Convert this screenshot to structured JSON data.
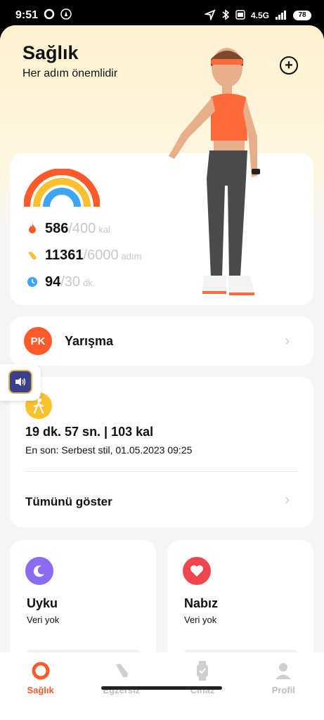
{
  "status_bar": {
    "time": "9:51",
    "network": "4.5G",
    "battery": "78",
    "icons": [
      "circle-icon",
      "notification-icon",
      "location-icon",
      "bluetooth-icon",
      "volte-icon",
      "signal-icon",
      "battery-icon"
    ]
  },
  "header": {
    "title": "Sağlık",
    "subtitle": "Her adım önemlidir",
    "add_icon": "plus-circle-icon"
  },
  "activity": {
    "colors": {
      "calories": "#ff5a2a",
      "steps": "#f9c12e",
      "minutes": "#3ea5f4"
    },
    "calories": {
      "value": "586",
      "goal": "/400",
      "unit": "kal"
    },
    "steps": {
      "value": "11361",
      "goal": "/6000",
      "unit": "adım"
    },
    "minutes": {
      "value": "94",
      "goal": "/30",
      "unit": "dk."
    }
  },
  "competition": {
    "badge": "PK",
    "label": "Yarışma"
  },
  "workout": {
    "stats": "19 dk. 57 sn. | 103 kal",
    "last": "En son: Serbest stil, 01.05.2023 09:25",
    "show_all": "Tümünü göster"
  },
  "tiles": {
    "sleep": {
      "title": "Uyku",
      "subtitle": "Veri yok",
      "color": "#8a6cf3"
    },
    "heart": {
      "title": "Nabız",
      "subtitle": "Veri yok",
      "color": "#f0454f"
    }
  },
  "nav": {
    "items": [
      {
        "label": "Sağlık",
        "icon": "health-ring-icon",
        "active": true
      },
      {
        "label": "Egzersiz",
        "icon": "shoe-icon",
        "active": false
      },
      {
        "label": "Cihaz",
        "icon": "watch-icon",
        "active": false
      },
      {
        "label": "Profil",
        "icon": "person-icon",
        "active": false
      }
    ]
  },
  "brand_color": "#ff5a2a"
}
